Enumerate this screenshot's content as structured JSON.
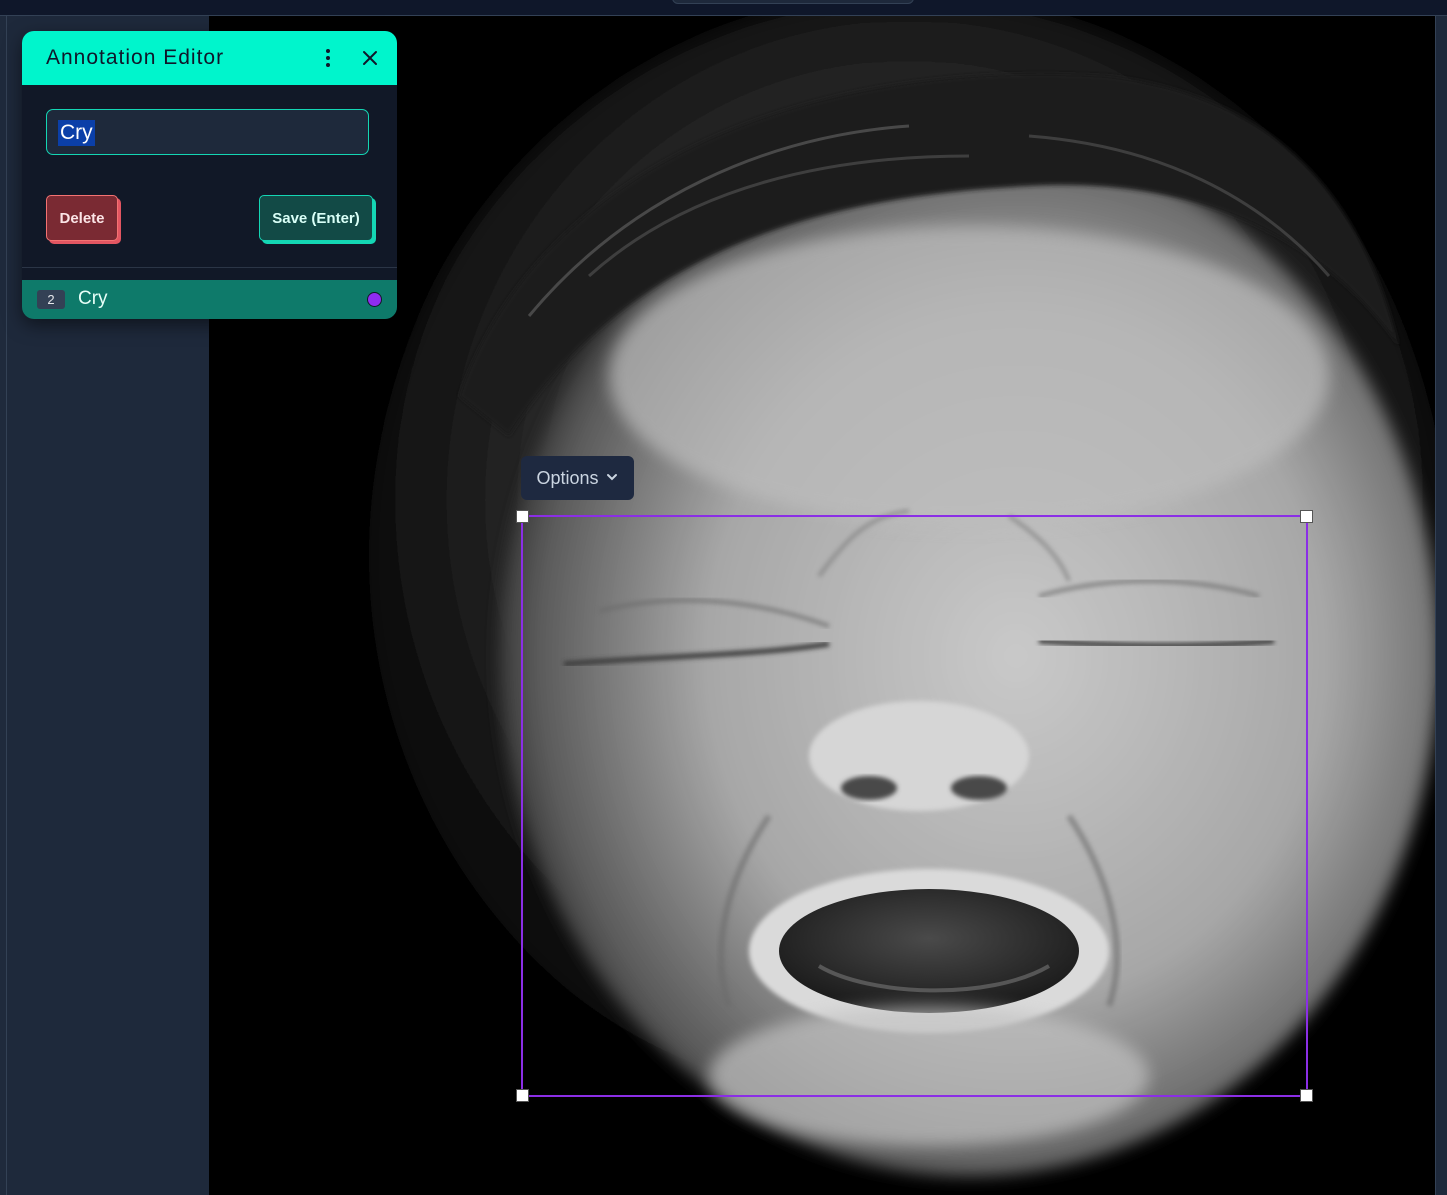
{
  "editor": {
    "title": "Annotation Editor",
    "label_value": "Cry",
    "delete_label": "Delete",
    "save_label": "Save (Enter)",
    "list": [
      {
        "index": "2",
        "label": "Cry",
        "color": "#8f2cf0"
      }
    ]
  },
  "toolbar": {
    "options_label": "Options"
  },
  "annotation": {
    "color": "#8b2ee6"
  },
  "colors": {
    "accent": "#00f5cc",
    "delete": "#7a2a33"
  },
  "icons": {
    "more": "more-vertical-icon",
    "close": "close-icon",
    "chevron": "chevron-down-icon"
  }
}
